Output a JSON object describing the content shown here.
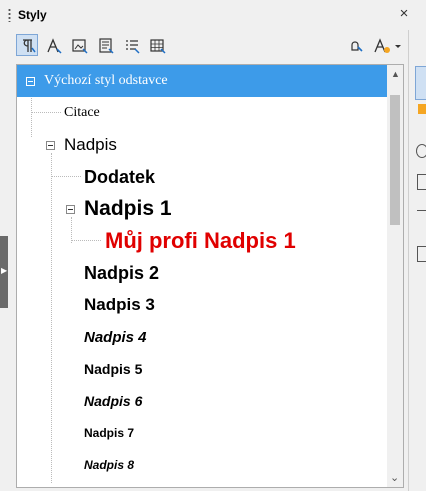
{
  "panel": {
    "title": "Styly",
    "close_icon": "×"
  },
  "toolbar": {
    "buttons": [
      {
        "name": "paragraph-styles-icon",
        "active": true
      },
      {
        "name": "character-styles-icon",
        "active": false
      },
      {
        "name": "frame-styles-icon",
        "active": false
      },
      {
        "name": "page-styles-icon",
        "active": false
      },
      {
        "name": "list-styles-icon",
        "active": false
      },
      {
        "name": "table-styles-icon",
        "active": false
      }
    ],
    "right_buttons": [
      {
        "name": "fill-format-mode-icon"
      },
      {
        "name": "new-style-icon"
      }
    ]
  },
  "tree": {
    "items": [
      {
        "label": "Výchozí styl odstavce",
        "selected": true
      },
      {
        "label": "Citace"
      },
      {
        "label": "Nadpis"
      },
      {
        "label": "Dodatek"
      },
      {
        "label": "Nadpis 1"
      },
      {
        "label": "Můj profi Nadpis 1"
      },
      {
        "label": "Nadpis 2"
      },
      {
        "label": "Nadpis 3"
      },
      {
        "label": "Nadpis 4"
      },
      {
        "label": "Nadpis 5"
      },
      {
        "label": "Nadpis 6"
      },
      {
        "label": "Nadpis 7"
      },
      {
        "label": "Nadpis 8"
      }
    ]
  },
  "colors": {
    "selection": "#3d9be9",
    "custom_style": "#e00000"
  }
}
